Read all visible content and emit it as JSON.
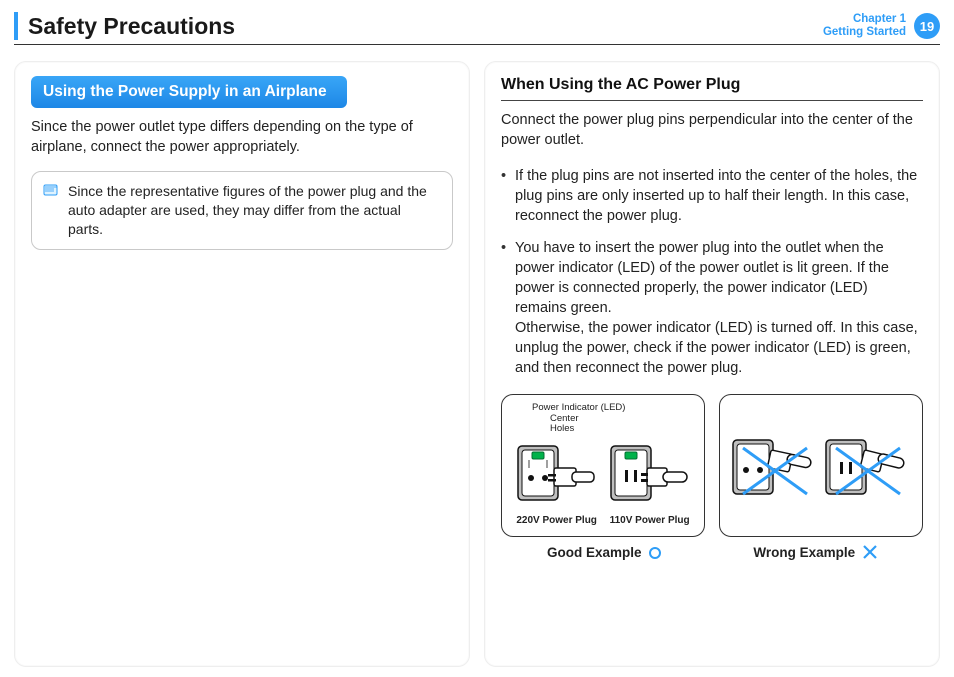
{
  "header": {
    "title": "Safety Precautions",
    "chapter_line1": "Chapter 1",
    "chapter_line2": "Getting Started",
    "page_number": "19"
  },
  "left": {
    "pill": "Using the Power Supply in an Airplane",
    "intro": "Since the power outlet type differs depending on the type of airplane, connect the power appropriately.",
    "note": "Since the representative figures of the power plug and the auto adapter are used, they may differ from the actual parts."
  },
  "right": {
    "subhead": "When Using the AC Power Plug",
    "intro": "Connect the power plug pins perpendicular into the center of the power outlet.",
    "bullets": [
      "If the plug pins are not inserted into the center of the holes, the plug pins are only inserted up to half their length. In this case, reconnect the power plug.",
      "You have to insert the power plug into the outlet when the power indicator (LED) of the power outlet is lit green. If the power is connected properly, the power indicator (LED) remains green.\nOtherwise, the power indicator (LED) is turned off. In this case, unplug the power, check if the power indicator (LED) is green, and then reconnect the power plug."
    ],
    "figure_good": {
      "callout_led": "Power Indicator (LED)",
      "callout_center": "Center",
      "callout_holes": "Holes",
      "label_220": "220V Power Plug",
      "label_110": "110V Power Plug",
      "footer": "Good Example"
    },
    "figure_wrong": {
      "footer": "Wrong Example"
    }
  },
  "colors": {
    "accent": "#2e9df7",
    "led_green": "#00b24a"
  }
}
